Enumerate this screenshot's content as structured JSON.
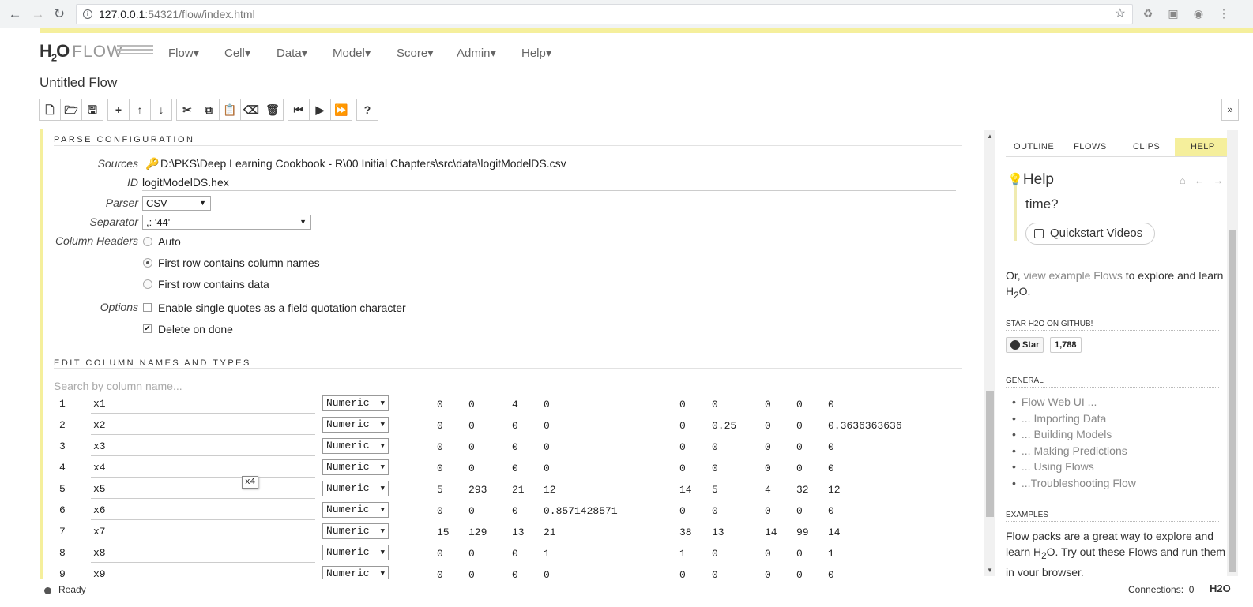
{
  "browser": {
    "url_host": "127.0.0.1",
    "url_rest": ":54321/flow/index.html"
  },
  "app": {
    "logo_h": "H",
    "logo_2": "2",
    "logo_o": "O",
    "logo_flow": "FLOW",
    "menu": [
      "Flow▾",
      "Cell▾",
      "Data▾",
      "Model▾",
      "Score▾",
      "Admin▾",
      "Help▾"
    ],
    "flow_title": "Untitled Flow"
  },
  "toolbar": {
    "icons": [
      [
        "new-file-icon",
        "open-folder-icon",
        "save-icon"
      ],
      [
        "insert-cell-icon",
        "move-up-icon",
        "move-down-icon"
      ],
      [
        "cut-icon",
        "copy-icon",
        "paste-icon",
        "clear-icon",
        "delete-icon"
      ],
      [
        "run-to-here-icon",
        "run-icon",
        "run-all-icon"
      ],
      [
        "help-icon"
      ]
    ]
  },
  "parse": {
    "section_title": "PARSE CONFIGURATION",
    "sources_label": "Sources",
    "sources_value": "D:\\PKS\\Deep Learning Cookbook - R\\00 Initial Chapters\\src\\data\\logitModelDS.csv",
    "id_label": "ID",
    "id_value": "logitModelDS.hex",
    "parser_label": "Parser",
    "parser_value": "CSV",
    "separator_label": "Separator",
    "separator_value": ",: '44'",
    "column_headers_label": "Column Headers",
    "header_options": [
      "Auto",
      "First row contains column names",
      "First row contains data"
    ],
    "header_selected": 1,
    "options_label": "Options",
    "option_single_quotes": "Enable single quotes as a field quotation character",
    "option_delete": "Delete on done",
    "single_quotes_checked": false,
    "delete_checked": true
  },
  "columns": {
    "section_title": "EDIT COLUMN NAMES AND TYPES",
    "search_placeholder": "Search by column name...",
    "rows": [
      {
        "num": "1",
        "name": "x1",
        "type": "Numeric",
        "vals": [
          "0",
          "0",
          "4",
          "0",
          "0",
          "0",
          "0",
          "0",
          "0"
        ]
      },
      {
        "num": "2",
        "name": "x2",
        "type": "Numeric",
        "vals": [
          "0",
          "0",
          "0",
          "0",
          "0",
          "0.25",
          "0",
          "0",
          "0.3636363636"
        ]
      },
      {
        "num": "3",
        "name": "x3",
        "type": "Numeric",
        "vals": [
          "0",
          "0",
          "0",
          "0",
          "0",
          "0",
          "0",
          "0",
          "0"
        ]
      },
      {
        "num": "4",
        "name": "x4",
        "type": "Numeric",
        "vals": [
          "0",
          "0",
          "0",
          "0",
          "0",
          "0",
          "0",
          "0",
          "0"
        ]
      },
      {
        "num": "5",
        "name": "x5",
        "type": "Numeric",
        "vals": [
          "5",
          "293",
          "21",
          "12",
          "14",
          "5",
          "4",
          "32",
          "12"
        ]
      },
      {
        "num": "6",
        "name": "x6",
        "type": "Numeric",
        "vals": [
          "0",
          "0",
          "0",
          "0.8571428571",
          "0",
          "0",
          "0",
          "0",
          "0"
        ]
      },
      {
        "num": "7",
        "name": "x7",
        "type": "Numeric",
        "vals": [
          "15",
          "129",
          "13",
          "21",
          "38",
          "13",
          "14",
          "99",
          "14"
        ]
      },
      {
        "num": "8",
        "name": "x8",
        "type": "Numeric",
        "vals": [
          "0",
          "0",
          "0",
          "1",
          "1",
          "0",
          "0",
          "0",
          "1"
        ]
      },
      {
        "num": "9",
        "name": "x9",
        "type": "Numeric",
        "vals": [
          "0",
          "0",
          "0",
          "0",
          "0",
          "0",
          "0",
          "0",
          "0"
        ]
      }
    ],
    "tooltip": "x4"
  },
  "help_panel": {
    "tabs": [
      "OUTLINE",
      "FLOWS",
      "CLIPS",
      "HELP"
    ],
    "active_tab": 3,
    "title": "Help",
    "time_question": "time?",
    "quickstart": "Quickstart Videos",
    "para1_pre": "Or, ",
    "para1_link": "view example Flows",
    "para1_post": " to explore and learn H",
    "para1_sub": "2",
    "para1_end": "O.",
    "star_heading": "STAR H2O ON GITHUB!",
    "star_label": "Star",
    "star_count": "1,788",
    "general_heading": "GENERAL",
    "general_items": [
      "Flow Web UI ...",
      "... Importing Data",
      "... Building Models",
      "... Making Predictions",
      "... Using Flows",
      "...Troubleshooting Flow"
    ],
    "examples_heading": "EXAMPLES",
    "para2_a": "Flow packs are a great way to explore and learn H",
    "para2_sub": "2",
    "para2_b": "O. Try out these Flows and run them in your browser."
  },
  "status": {
    "ready": "Ready",
    "connections_label": "Connections:",
    "connections_value": "0",
    "logo": "H2O"
  }
}
